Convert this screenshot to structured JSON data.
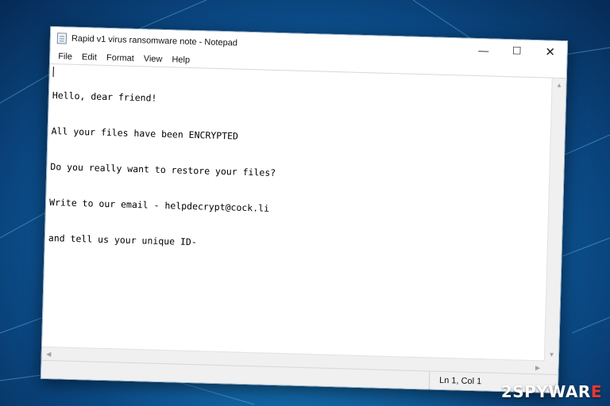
{
  "window": {
    "title": "Rapid v1 virus ransomware note - Notepad",
    "controls": {
      "minimize": "—",
      "maximize": "☐",
      "close": "✕"
    }
  },
  "menu": [
    "File",
    "Edit",
    "Format",
    "View",
    "Help"
  ],
  "document": {
    "lines": [
      "Hello, dear friend!",
      "All your files have been ENCRYPTED",
      "Do you really want to restore your files?",
      "Write to our email - helpdecrypt@cock.li",
      "and tell us your unique ID-"
    ]
  },
  "status": {
    "position": "Ln 1, Col 1"
  },
  "watermark": {
    "prefix": "2",
    "middle": "SPYWAR",
    "suffix": "E"
  },
  "colors": {
    "background": "#1676b8",
    "watermark_accent": "#e53935"
  }
}
